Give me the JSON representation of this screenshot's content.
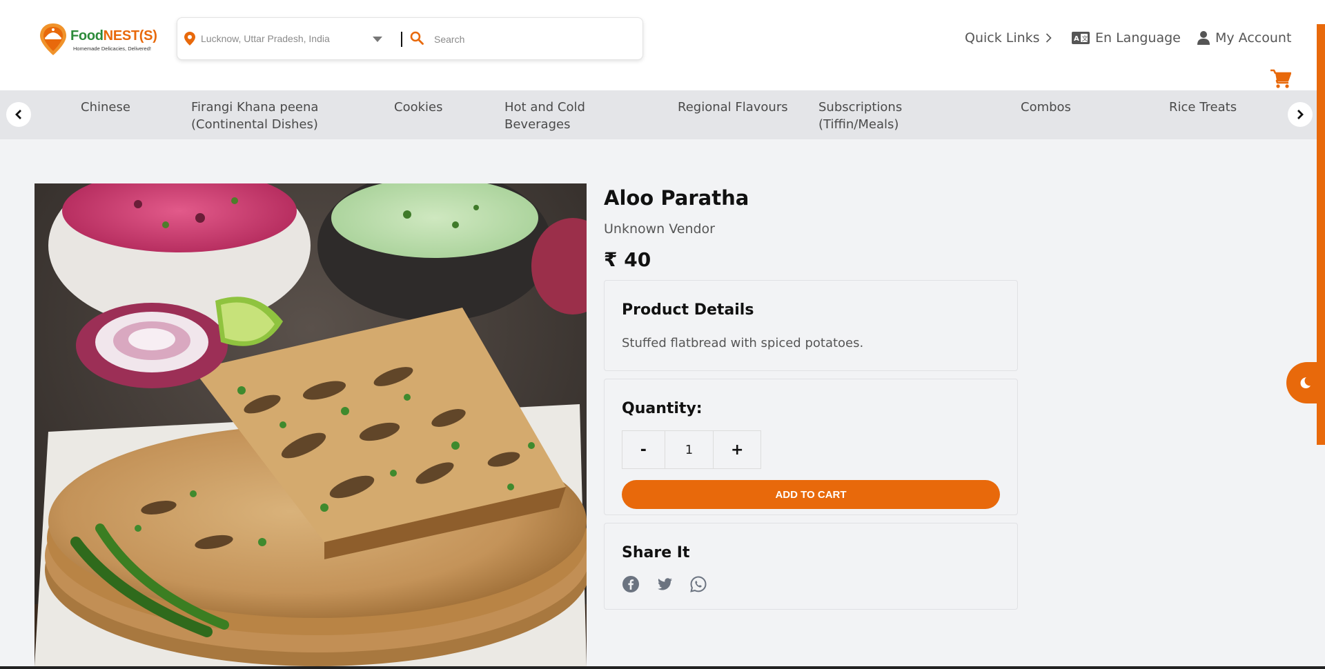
{
  "brand": {
    "name_part1": "Food",
    "name_part2": "NEST(S)",
    "tagline": "Homemade Delicacies, Delivered!",
    "accent_color": "#e8690b",
    "green_color": "#2c8b3a"
  },
  "search": {
    "location": "Lucknow, Uttar Pradesh, India",
    "placeholder": "Search",
    "divider": "|"
  },
  "header_links": {
    "quick_links": "Quick Links",
    "language": "En Language",
    "account": "My Account"
  },
  "categories": [
    {
      "line1": "Chinese",
      "line2": ""
    },
    {
      "line1": "Firangi Khana peena",
      "line2": "(Continental Dishes)"
    },
    {
      "line1": "Cookies",
      "line2": ""
    },
    {
      "line1": "Hot and Cold",
      "line2": "Beverages"
    },
    {
      "line1": "Regional Flavours",
      "line2": ""
    },
    {
      "line1": "Subscriptions",
      "line2": "(Tiffin/Meals)"
    },
    {
      "line1": "Combos",
      "line2": ""
    },
    {
      "line1": "Rice Treats",
      "line2": ""
    }
  ],
  "product": {
    "title": "Aloo Paratha",
    "vendor": "Unknown Vendor",
    "price": "₹ 40",
    "details_heading": "Product Details",
    "details_text": "Stuffed flatbread with spiced potatoes.",
    "quantity_label": "Quantity:",
    "quantity": "1",
    "minus_label": "-",
    "plus_label": "+",
    "add_to_cart": "ADD TO CART",
    "share_heading": "Share It"
  },
  "icons": {
    "location": "map-pin-icon",
    "search": "search-icon",
    "language": "language-card-icon",
    "account": "user-icon",
    "cart": "cart-icon",
    "theme": "moon-icon",
    "share": [
      "facebook-icon",
      "twitter-icon",
      "whatsapp-icon"
    ]
  }
}
